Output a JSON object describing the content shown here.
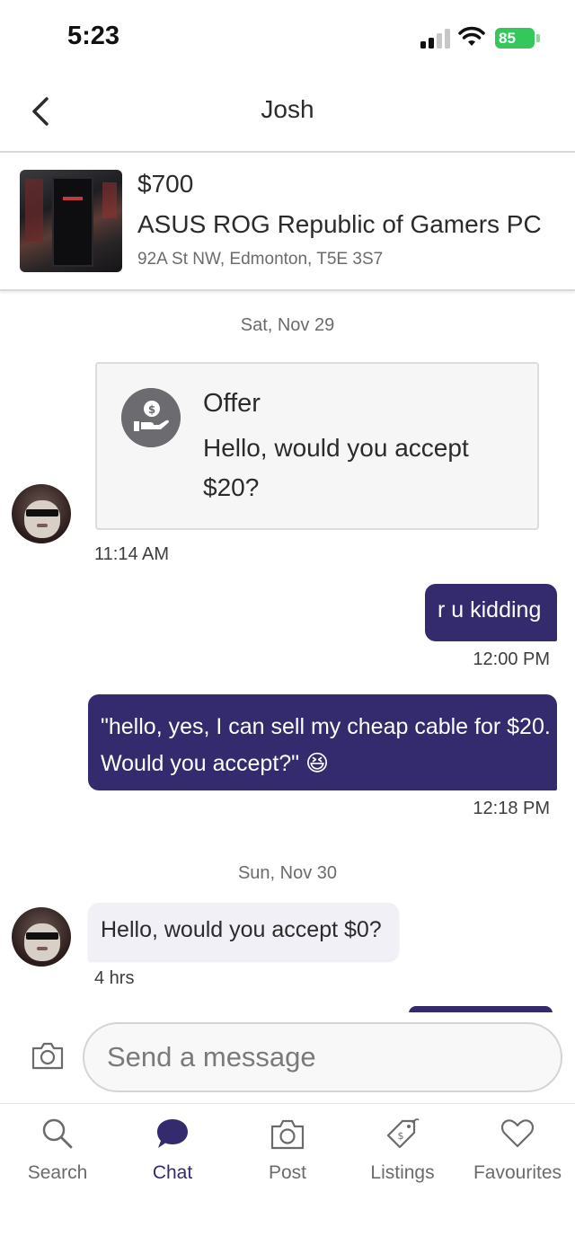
{
  "status_bar": {
    "time": "5:23",
    "battery": "85"
  },
  "header": {
    "title": "Josh"
  },
  "listing": {
    "price": "$700",
    "title": "ASUS ROG Republic of Gamers PC",
    "address": "92A St NW, Edmonton, T5E 3S7"
  },
  "chat": {
    "date_1": "Sat, Nov 29",
    "offer": {
      "title": "Offer",
      "text": "Hello, would you accept $20?",
      "time": "11:14 AM"
    },
    "msg_1": {
      "text": "r u kidding",
      "time": "12:00 PM"
    },
    "msg_2": {
      "line1": "\"hello, yes, I can sell my cheap cable for $20.",
      "line2": "Would you accept?\"",
      "emoji": "😆",
      "time": "12:18 PM"
    },
    "date_2": "Sun, Nov 30",
    "msg_3": {
      "text": "Hello, would you accept $0?",
      "time": "4 hrs"
    }
  },
  "composer": {
    "placeholder": "Send a message"
  },
  "tabbar": {
    "search": "Search",
    "chat": "Chat",
    "post": "Post",
    "listings": "Listings",
    "favourites": "Favourites"
  },
  "colors": {
    "accent": "#332b6d",
    "battery": "#34c759",
    "incoming_bubble": "#f1f0f7"
  }
}
